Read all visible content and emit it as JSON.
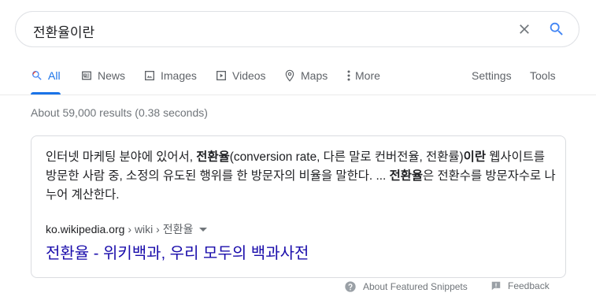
{
  "search": {
    "query": "전환율이란"
  },
  "tabs": [
    {
      "label": "All",
      "icon": "search-icon",
      "active": true
    },
    {
      "label": "News",
      "icon": "news-icon"
    },
    {
      "label": "Images",
      "icon": "image-icon"
    },
    {
      "label": "Videos",
      "icon": "video-icon"
    },
    {
      "label": "Maps",
      "icon": "map-pin-icon"
    },
    {
      "label": "More",
      "icon": "more-vert-icon"
    }
  ],
  "tools": {
    "settings": "Settings",
    "tools": "Tools"
  },
  "stats": "About 59,000 results (0.38 seconds)",
  "featured": {
    "snippet": {
      "p1": "인터넷 마케팅 분야에 있어서, ",
      "b1": "전환율",
      "p2": "(conversion rate, 다른 말로 컨버전율, 전환률)",
      "b2": "이란",
      "p3": " 웹사이트를 방문한 사람 중, 소정의 유도된 행위를 한 방문자의 비율을 말한다. ... ",
      "b3": "전환율",
      "p4": "은 전환수를 방문자수로 나누어 계산한다."
    },
    "domain": "ko.wikipedia.org",
    "crumbs": "› wiki › 전환율",
    "title": "전환율 - 위키백과, 우리 모두의 백과사전"
  },
  "footer": {
    "about": "About Featured Snippets",
    "feedback": "Feedback"
  },
  "colors": {
    "accent": "#1a73e8",
    "link": "#1a0dab",
    "muted": "#70757a"
  }
}
